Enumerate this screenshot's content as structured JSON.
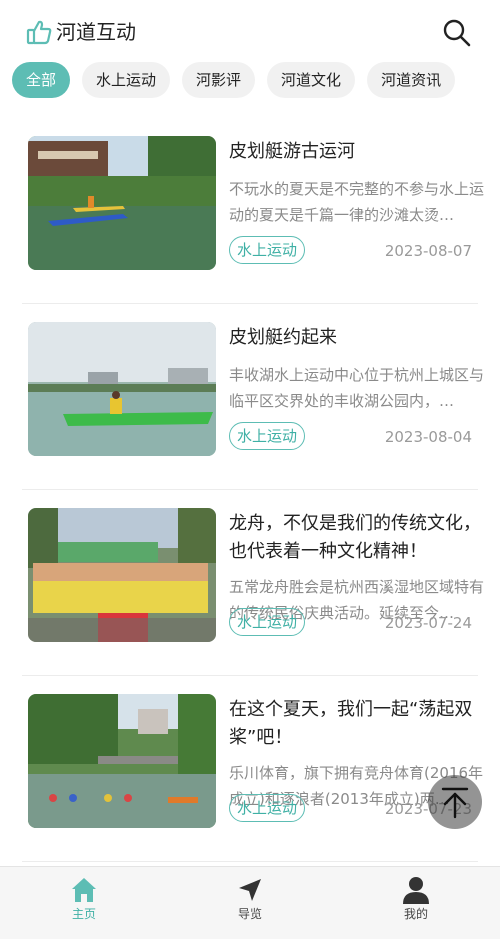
{
  "header": {
    "title": "河道互动"
  },
  "tabs": [
    {
      "label": "全部",
      "active": true
    },
    {
      "label": "水上运动",
      "active": false
    },
    {
      "label": "河影评",
      "active": false
    },
    {
      "label": "河道文化",
      "active": false
    },
    {
      "label": "河道资讯",
      "active": false
    }
  ],
  "articles": [
    {
      "title": "皮划艇游古运河",
      "desc": "不玩水的夏天是不完整的不参与水上运动的夏天是千篇一律的沙滩太烫…",
      "tag": "水上运动",
      "date": "2023-08-07"
    },
    {
      "title": "皮划艇约起来",
      "desc": "丰收湖水上运动中心位于杭州上城区与临平区交界处的丰收湖公园内，…",
      "tag": "水上运动",
      "date": "2023-08-04"
    },
    {
      "title": "龙舟，不仅是我们的传统文化，也代表着一种文化精神！",
      "desc": "五常龙舟胜会是杭州西溪湿地区域特有的传统民俗庆典活动。延续至今…",
      "tag": "水上运动",
      "date": "2023-07-24"
    },
    {
      "title": "在这个夏天，我们一起“荡起双桨”吧！",
      "desc": "乐川体育，旗下拥有竞舟体育(2016年成立)和逐浪者(2013年成立)两…",
      "tag": "水上运动",
      "date": "2023-07-23"
    }
  ],
  "nav": [
    {
      "label": "主页",
      "icon": "home-icon",
      "active": true
    },
    {
      "label": "导览",
      "icon": "navigation-arrow-icon",
      "active": false
    },
    {
      "label": "我的",
      "icon": "user-icon",
      "active": false
    }
  ],
  "colors": {
    "accent": "#5dbdb4",
    "tag_text": "#3fb0a5"
  }
}
